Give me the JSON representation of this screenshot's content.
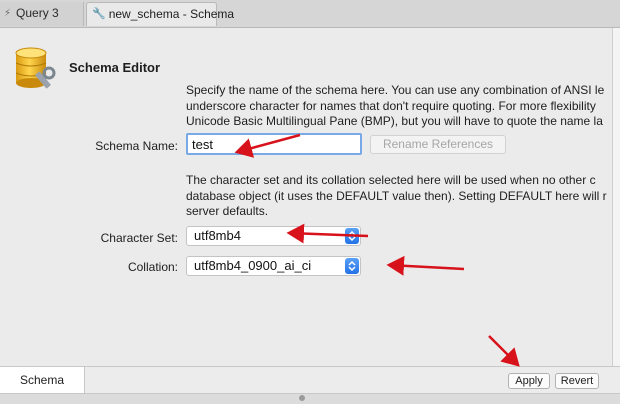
{
  "tabs": [
    {
      "label": "Query 3",
      "icon": "lightning-icon"
    },
    {
      "label": "new_schema - Schema",
      "icon": "wrench-icon"
    }
  ],
  "editor": {
    "title": "Schema Editor",
    "icon": "database-icon",
    "description_name": [
      "Specify the name of the schema here. You can use any combination of ANSI le",
      "underscore character for names that don't require quoting. For more flexibility",
      "Unicode Basic Multilingual Pane (BMP), but you will have to quote the name la"
    ],
    "schema_name_label": "Schema Name:",
    "schema_name_value": "test",
    "rename_button": "Rename References",
    "description_charset": [
      "The character set and its collation selected here will be used when no other c",
      "database object (it uses the DEFAULT value then). Setting DEFAULT here will r",
      "server defaults."
    ],
    "charset_label": "Character Set:",
    "charset_value": "utf8mb4",
    "collation_label": "Collation:",
    "collation_value": "utf8mb4_0900_ai_ci"
  },
  "bottom": {
    "tab_label": "Schema",
    "apply_label": "Apply",
    "revert_label": "Revert"
  },
  "colors": {
    "annotation_arrow": "#d8121b",
    "select_arrow_accent": "#2f7cf0",
    "focus_ring": "#78a9e6"
  }
}
